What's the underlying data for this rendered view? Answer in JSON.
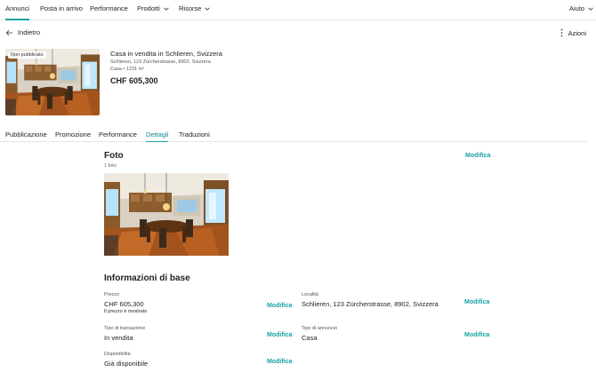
{
  "nav": {
    "items": [
      {
        "label": "Annunci"
      },
      {
        "label": "Posta in arrivo"
      },
      {
        "label": "Performance"
      },
      {
        "label": "Prodotti"
      },
      {
        "label": "Risorse"
      }
    ],
    "help": "Aiuto"
  },
  "back_label": "Indietro",
  "actions_label": "Azioni",
  "listing": {
    "badge": "Non pubblicato",
    "title": "Casa in vendita in Schlieren, Svizzera",
    "address": "Schlieren, 123 Zürcherstrasse, 8902, Svizzera",
    "meta": "Casa • 1231 m²",
    "price": "CHF 605,300"
  },
  "tabs": [
    {
      "label": "Pubblicazione"
    },
    {
      "label": "Promozione"
    },
    {
      "label": "Performance"
    },
    {
      "label": "Dettagli"
    },
    {
      "label": "Traduzioni"
    }
  ],
  "photos": {
    "title": "Foto",
    "count": "1 foto",
    "edit": "Modifica"
  },
  "basic": {
    "title": "Informazioni di base",
    "edit": "Modifica",
    "fields": {
      "price": {
        "label": "Prezzo",
        "value": "CHF 605,300",
        "note": "Il prezzo è mostrato"
      },
      "location": {
        "label": "Località",
        "value": "Schlieren, 123 Zürcherstrasse, 8902, Svizzera"
      },
      "transaction": {
        "label": "Tipo di transazione",
        "value": "In vendita"
      },
      "listing_type": {
        "label": "Tipo di annuncio",
        "value": "Casa"
      },
      "availability": {
        "label": "Disponibilità",
        "value": "Già disponibile"
      }
    }
  },
  "colors": {
    "accent": "#17a2a2",
    "text": "#1f1f1f",
    "divider": "#e6e6e6"
  }
}
